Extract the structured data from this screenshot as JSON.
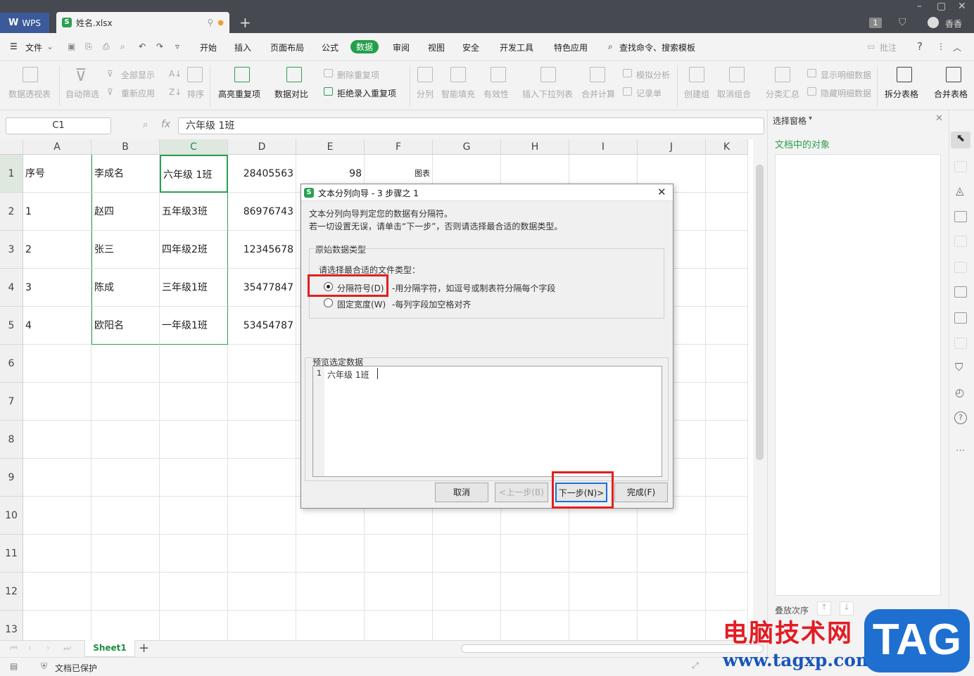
{
  "titlebar": {
    "app_tab": "WPS",
    "file_tab": "姓名.xlsx",
    "user": "香香",
    "badge": "1"
  },
  "menu": {
    "file": "文件",
    "items": [
      "开始",
      "插入",
      "页面布局",
      "公式",
      "数据",
      "审阅",
      "视图",
      "安全",
      "开发工具",
      "特色应用"
    ],
    "active": "数据",
    "search": "查找命令、搜索模板",
    "annotate": "批注",
    "help": "?"
  },
  "ribbon": {
    "pivot": "数据透视表",
    "autofilter": "自动筛选",
    "show_all": "全部显示",
    "reapply": "重新应用",
    "sort": "排序",
    "highlight_dup": "高亮重复项",
    "compare": "数据对比",
    "remove_dup": "删除重复项",
    "reject_dup": "拒绝录入重复项",
    "split": "分列",
    "smart_fill": "智能填充",
    "validity": "有效性",
    "insert_dropdown": "插入下拉列表",
    "consolidate": "合并计算",
    "simulation": "模拟分析",
    "record": "记录单",
    "create_group": "创建组",
    "ungroup": "取消组合",
    "subtotal": "分类汇总",
    "show_detail": "显示明细数据",
    "hide_detail": "隐藏明细数据",
    "split_table": "拆分表格",
    "merge_table": "合并表格"
  },
  "formula_bar": {
    "cell_ref": "C1",
    "fx": "fx",
    "value": "六年级 1班"
  },
  "sheet": {
    "columns": [
      "A",
      "B",
      "C",
      "D",
      "E",
      "F",
      "G",
      "H",
      "I",
      "J",
      "K"
    ],
    "rows": [
      "1",
      "2",
      "3",
      "4",
      "5",
      "6",
      "7",
      "8",
      "9",
      "10",
      "11",
      "12",
      "13"
    ],
    "data": [
      [
        "序号",
        "李成名",
        "六年级 1班",
        "28405563",
        "98",
        "图表"
      ],
      [
        "1",
        "赵四",
        "五年级3班",
        "86976743",
        "",
        ""
      ],
      [
        "2",
        "张三",
        "四年级2班",
        "12345678",
        "",
        ""
      ],
      [
        "3",
        "陈成",
        "三年级1班",
        "35477847",
        "",
        ""
      ],
      [
        "4",
        "欧阳名",
        "一年级1班",
        "53454787",
        "",
        ""
      ]
    ],
    "tab": "Sheet1"
  },
  "side_panel": {
    "title": "选择窗格",
    "objects": "文档中的对象",
    "order": "叠放次序"
  },
  "status": {
    "protect": "文档已保护"
  },
  "dialog": {
    "title": "文本分列向导 - 3 步骤之 1",
    "desc1": "文本分列向导判定您的数据有分隔符。",
    "desc2": "若一切设置无误，请单击“下一步”，否则请选择最合适的数据类型。",
    "group": "原始数据类型",
    "prompt": "请选择最合适的文件类型：",
    "opt1": "分隔符号(D)",
    "opt1_desc": "-用分隔字符，如逗号或制表符分隔每个字段",
    "opt2": "固定宽度(W)",
    "opt2_desc": "-每列字段加空格对齐",
    "preview_label": "预览选定数据",
    "preview_row": "1",
    "preview_text": "六年级 1班",
    "cancel": "取消",
    "back": "<上一步(B)",
    "next": "下一步(N)>",
    "finish": "完成(F)"
  },
  "watermark": {
    "line1": "电脑技术网",
    "line2": "www.tagxp.com",
    "tag": "TAG"
  }
}
